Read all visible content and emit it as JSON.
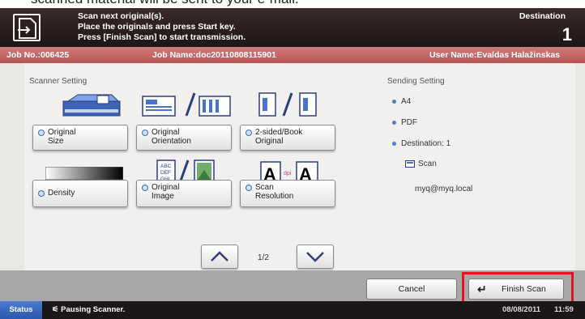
{
  "top_caption": "scanned material will be sent to your e-mail.",
  "header": {
    "message_lines": [
      "Scan next original(s).",
      "Place the originals and press Start key.",
      "Press [Finish Scan] to start transmission."
    ],
    "destination_label": "Destination",
    "destination_count": "1"
  },
  "job_bar": {
    "job_no": "Job No.:006425",
    "job_name": "Job Name:doc20110808115901",
    "user_name": "User Name:Evaldas Halažinskas"
  },
  "scanner_setting": {
    "title": "Scanner Setting",
    "buttons": [
      {
        "label": "Original\nSize",
        "icon": "document-on-glass-icon"
      },
      {
        "label": "Original\nOrientation",
        "icon": "orientation-pages-icon"
      },
      {
        "label": "2-sided/Book\nOriginal",
        "icon": "two-sided-pages-icon"
      },
      {
        "label": "Density",
        "icon": "density-gradient-icon"
      },
      {
        "label": "Original\nImage",
        "icon": "text-photo-icon"
      },
      {
        "label": "Scan\nResolution",
        "icon": "dpi-letters-icon"
      }
    ],
    "icon_text": {
      "abc": "ABC",
      "def": "DEF",
      "ghi": "GHI",
      "resolution_letter": "A",
      "dpi": "dpi"
    }
  },
  "sending_setting": {
    "title": "Sending Setting",
    "items": [
      "A4",
      "PDF",
      "Destination: 1"
    ],
    "destination_type": "Scan",
    "destination_address": "myq@myq.local"
  },
  "pagination": {
    "page": "1/2"
  },
  "footer": {
    "cancel_label": "Cancel",
    "finish_label": "Finish Scan"
  },
  "status_bar": {
    "tab_label": "Status",
    "message": "Pausing Scanner.",
    "date": "08/08/2011",
    "time": "11:59"
  },
  "colors": {
    "header_bg": "#2b1f20",
    "job_bar": "#c46466",
    "highlight": "#e0151e",
    "status_tab": "#3565c0"
  }
}
